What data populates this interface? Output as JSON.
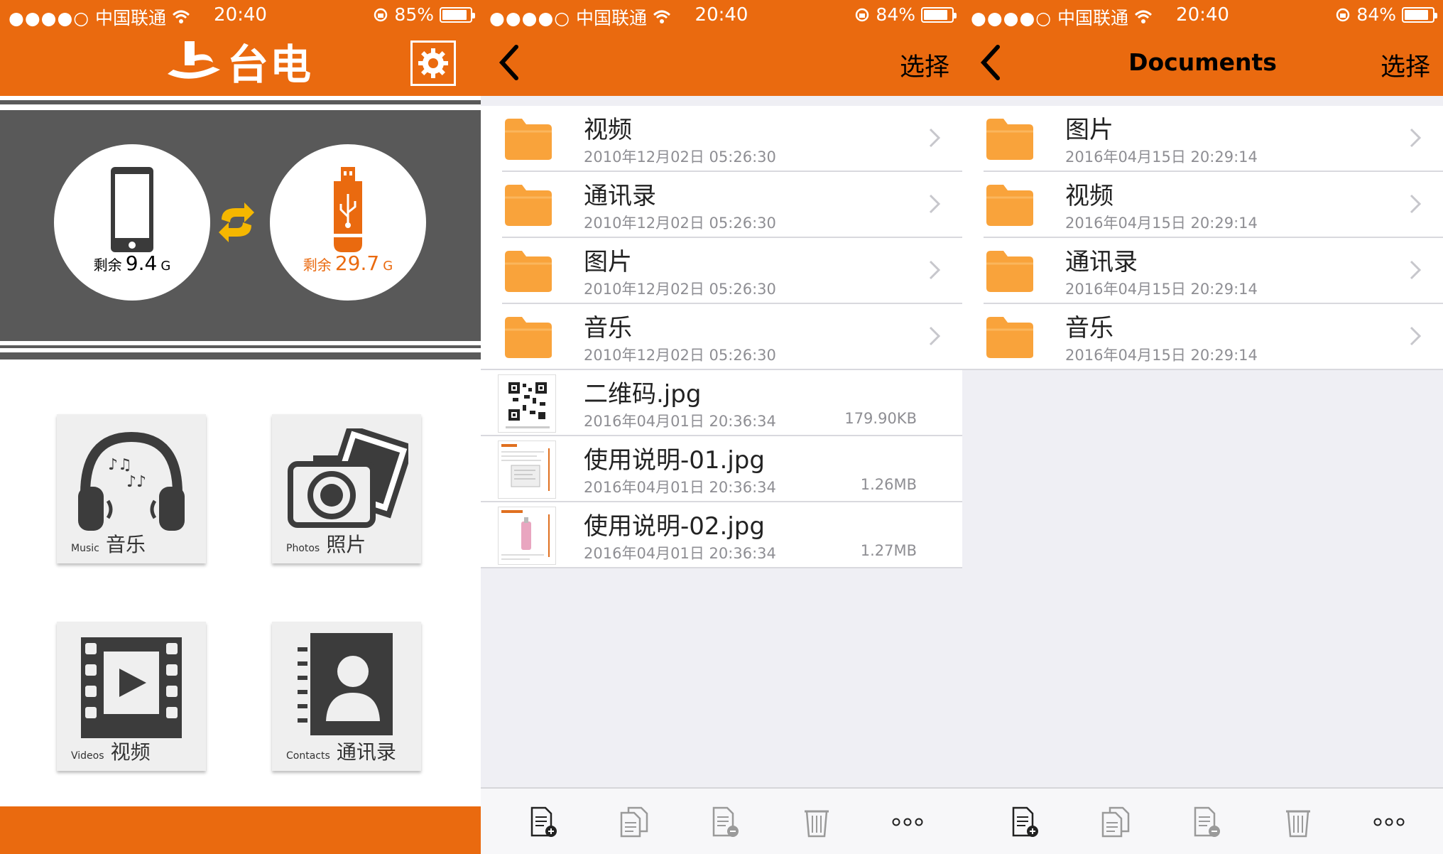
{
  "status_bars": [
    {
      "carrier": "中国联通",
      "signal": "●●●●○",
      "time": "20:40",
      "battery": "85%",
      "battery_level": 0.85
    },
    {
      "carrier": "中国联通",
      "signal": "●●●●○",
      "time": "20:40",
      "battery": "84%",
      "battery_level": 0.84
    },
    {
      "carrier": "中国联通",
      "signal": "●●●●○",
      "time": "20:40",
      "battery": "84%",
      "battery_level": 0.84
    }
  ],
  "home": {
    "logo_text": "台电",
    "phone_storage": {
      "label": "剩余",
      "value": "9.4",
      "unit": "G"
    },
    "usb_storage": {
      "label": "剩余",
      "value": "29.7",
      "unit": "G"
    },
    "tiles": [
      {
        "en": "Music",
        "zh": "音乐",
        "icon": "headphones-icon"
      },
      {
        "en": "Photos",
        "zh": "照片",
        "icon": "camera-icon"
      },
      {
        "en": "Videos",
        "zh": "视频",
        "icon": "film-icon"
      },
      {
        "en": "Contacts",
        "zh": "通讯录",
        "icon": "contact-book-icon"
      }
    ]
  },
  "browser": {
    "title": "",
    "action": "选择",
    "items": [
      {
        "name": "视频",
        "date": "2010年12月02日 05:26:30",
        "type": "folder"
      },
      {
        "name": "通讯录",
        "date": "2010年12月02日 05:26:30",
        "type": "folder"
      },
      {
        "name": "图片",
        "date": "2010年12月02日 05:26:30",
        "type": "folder"
      },
      {
        "name": "音乐",
        "date": "2010年12月02日 05:26:30",
        "type": "folder"
      },
      {
        "name": "二维码.jpg",
        "date": "2016年04月01日 20:36:34",
        "size": "179.90KB",
        "type": "image"
      },
      {
        "name": "使用说明-01.jpg",
        "date": "2016年04月01日 20:36:34",
        "size": "1.26MB",
        "type": "image"
      },
      {
        "name": "使用说明-02.jpg",
        "date": "2016年04月01日 20:36:34",
        "size": "1.27MB",
        "type": "image"
      }
    ]
  },
  "documents": {
    "title": "Documents",
    "action": "选择",
    "items": [
      {
        "name": "图片",
        "date": "2016年04月15日 20:29:14",
        "type": "folder"
      },
      {
        "name": "视频",
        "date": "2016年04月15日 20:29:14",
        "type": "folder"
      },
      {
        "name": "通讯录",
        "date": "2016年04月15日 20:29:14",
        "type": "folder"
      },
      {
        "name": "音乐",
        "date": "2016年04月15日 20:29:14",
        "type": "folder"
      }
    ]
  },
  "toolbar_icons": [
    "new-file-icon",
    "copy-icon",
    "remove-file-icon",
    "trash-icon",
    "more-icon"
  ],
  "colors": {
    "accent": "#ea6a0f",
    "folder": "#f9a33b",
    "band": "#595959",
    "sync": "#f5b700"
  }
}
